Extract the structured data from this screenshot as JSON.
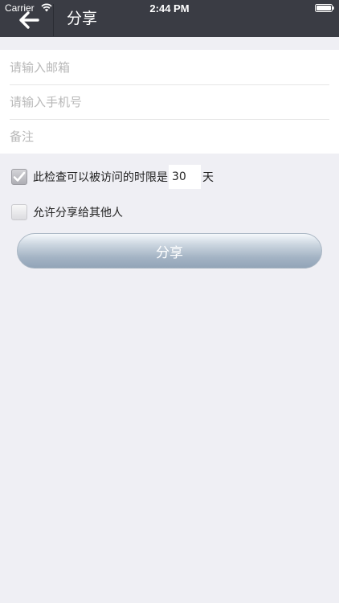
{
  "status_bar": {
    "carrier": "Carrier",
    "time": "2:44 PM"
  },
  "nav": {
    "back_icon": "back-arrow-icon",
    "title": "分享"
  },
  "form": {
    "email": {
      "placeholder": "请输入邮箱",
      "value": ""
    },
    "phone": {
      "placeholder": "请输入手机号",
      "value": ""
    },
    "note": {
      "placeholder": "备注",
      "value": ""
    }
  },
  "options": {
    "access_limit": {
      "checked": true,
      "label": "此检查可以被访问的时限是",
      "days": "30",
      "unit": "天"
    },
    "allow_share": {
      "checked": false,
      "label": "允许分享给其他人"
    }
  },
  "share_button": {
    "label": "分享"
  },
  "colors": {
    "nav_background": "#3a3c44",
    "page_background": "#efeff4",
    "button_gradient_bottom": "#92a4b8"
  }
}
